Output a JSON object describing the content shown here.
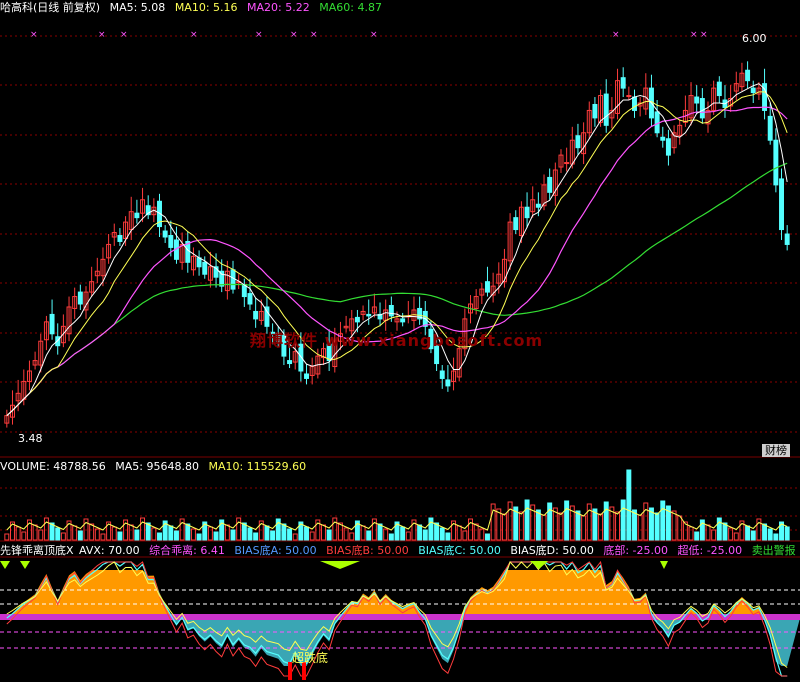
{
  "colors": {
    "bg": "#000000",
    "up": "#ff3c3c",
    "down": "#54ffff",
    "ma5": "#ffffff",
    "ma10": "#ffff55",
    "ma20": "#ff55ff",
    "ma60": "#33dd33",
    "grid": "#8a0000",
    "orange": "#ff9900",
    "teal": "#3aa6b4",
    "magenta": "#cc33cc",
    "watermark": "#8a0000"
  },
  "price_panel": {
    "stock": "哈高科",
    "mode": "(日线 前复权)",
    "ma5_label": "MA5: 5.08",
    "ma10_label": "MA10: 5.16",
    "ma20_label": "MA20: 5.22",
    "ma60_label": "MA60: 4.87",
    "high_label": "6.00",
    "low_label": "3.48",
    "badge": "财榜",
    "watermark": "翔博软件 www.xiangbosoft.com"
  },
  "volume_panel": {
    "vol_label": "VOLUME: 48788.56",
    "ma5_label": "MA5: 95648.80",
    "ma10_label": "MA10: 115529.60"
  },
  "indicator_panel": {
    "name": "先锋乖离顶底X",
    "avx": "AVX: 70.00",
    "composite": "综合乖离: 6.41",
    "bias_a": "BIAS底A: 50.00",
    "bias_b": "BIAS底B: 50.00",
    "bias_c": "BIAS底C: 50.00",
    "bias_d": "BIAS底D: 50.00",
    "bottom": "底部: -25.00",
    "oversold": "超低: -25.00",
    "sell_alert": "卖出警报",
    "signal_text": "超跌底"
  },
  "chart_data": {
    "type": "candlestick",
    "y_range": [
      3.4,
      6.1
    ],
    "marked_high": 6.0,
    "marked_low": 3.48,
    "last_ma": {
      "ma5": 5.08,
      "ma10": 5.16,
      "ma20": 5.22,
      "ma60": 4.87
    },
    "last_volume": 48788.56,
    "volume_ma": {
      "ma5": 95648.8,
      "ma10": 115529.6
    },
    "close": [
      3.55,
      3.62,
      3.7,
      3.78,
      3.85,
      3.92,
      4.05,
      4.18,
      4.1,
      4.02,
      4.15,
      4.28,
      4.35,
      4.3,
      4.38,
      4.45,
      4.52,
      4.6,
      4.7,
      4.78,
      4.72,
      4.85,
      4.92,
      4.88,
      5.0,
      4.9,
      4.95,
      4.82,
      4.75,
      4.68,
      4.6,
      4.7,
      4.58,
      4.62,
      4.55,
      4.5,
      4.55,
      4.48,
      4.42,
      4.52,
      4.4,
      4.45,
      4.35,
      4.3,
      4.2,
      4.25,
      4.15,
      4.1,
      4.05,
      3.95,
      3.9,
      3.98,
      3.85,
      3.8,
      3.88,
      3.95,
      4.0,
      3.92,
      4.05,
      4.1,
      4.15,
      4.2,
      4.18,
      4.25,
      4.22,
      4.28,
      4.2,
      4.26,
      4.22,
      4.2,
      4.18,
      4.22,
      4.26,
      4.2,
      4.15,
      4.0,
      3.9,
      3.8,
      3.75,
      3.85,
      4.0,
      4.2,
      4.3,
      4.35,
      4.4,
      4.38,
      4.42,
      4.5,
      4.6,
      4.85,
      4.8,
      4.95,
      4.88,
      5.0,
      4.95,
      5.1,
      5.05,
      5.2,
      5.3,
      5.25,
      5.4,
      5.35,
      5.45,
      5.6,
      5.55,
      5.7,
      5.5,
      5.6,
      5.8,
      5.75,
      5.7,
      5.6,
      5.65,
      5.75,
      5.55,
      5.45,
      5.4,
      5.3,
      5.45,
      5.5,
      5.6,
      5.7,
      5.65,
      5.55,
      5.6,
      5.75,
      5.7,
      5.62,
      5.68,
      5.78,
      5.85,
      5.8,
      5.72,
      5.75,
      5.6,
      5.4,
      5.1,
      4.8,
      4.7
    ]
  }
}
